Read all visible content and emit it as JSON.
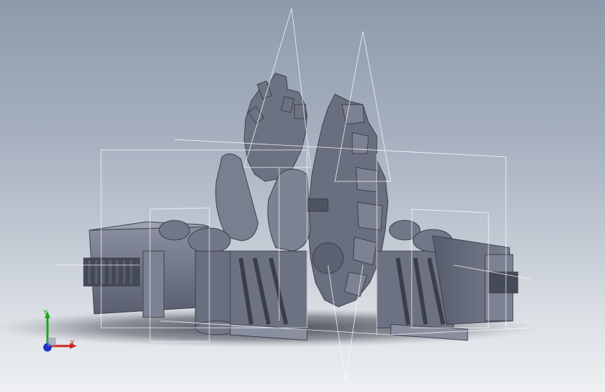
{
  "viewport": {
    "background_top": "#8e9aab",
    "background_bottom": "#eef0f2",
    "model_color": "#6d7282",
    "wireframe_color": "#ffffff"
  },
  "model": {
    "description_icon": "gear-assembly-model"
  },
  "triad": {
    "x_label": "X",
    "y_label": "Y",
    "x_color": "#d02020",
    "y_color": "#1aa51a",
    "z_color": "#1a33c8"
  }
}
